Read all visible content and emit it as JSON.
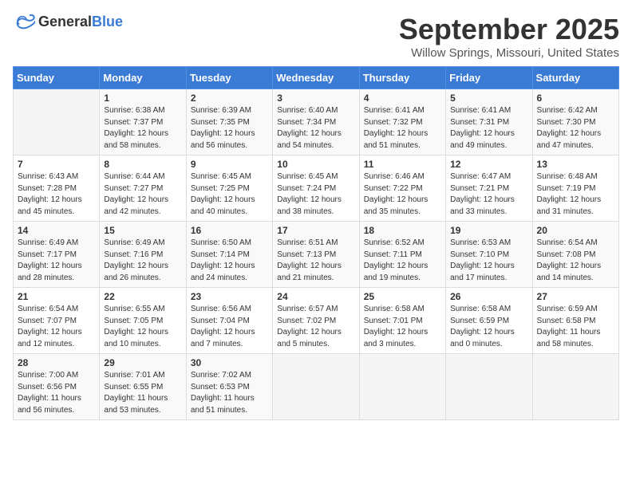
{
  "header": {
    "logo_general": "General",
    "logo_blue": "Blue",
    "month": "September 2025",
    "location": "Willow Springs, Missouri, United States"
  },
  "weekdays": [
    "Sunday",
    "Monday",
    "Tuesday",
    "Wednesday",
    "Thursday",
    "Friday",
    "Saturday"
  ],
  "weeks": [
    [
      {
        "day": "",
        "sunrise": "",
        "sunset": "",
        "daylight": ""
      },
      {
        "day": "1",
        "sunrise": "Sunrise: 6:38 AM",
        "sunset": "Sunset: 7:37 PM",
        "daylight": "Daylight: 12 hours and 58 minutes."
      },
      {
        "day": "2",
        "sunrise": "Sunrise: 6:39 AM",
        "sunset": "Sunset: 7:35 PM",
        "daylight": "Daylight: 12 hours and 56 minutes."
      },
      {
        "day": "3",
        "sunrise": "Sunrise: 6:40 AM",
        "sunset": "Sunset: 7:34 PM",
        "daylight": "Daylight: 12 hours and 54 minutes."
      },
      {
        "day": "4",
        "sunrise": "Sunrise: 6:41 AM",
        "sunset": "Sunset: 7:32 PM",
        "daylight": "Daylight: 12 hours and 51 minutes."
      },
      {
        "day": "5",
        "sunrise": "Sunrise: 6:41 AM",
        "sunset": "Sunset: 7:31 PM",
        "daylight": "Daylight: 12 hours and 49 minutes."
      },
      {
        "day": "6",
        "sunrise": "Sunrise: 6:42 AM",
        "sunset": "Sunset: 7:30 PM",
        "daylight": "Daylight: 12 hours and 47 minutes."
      }
    ],
    [
      {
        "day": "7",
        "sunrise": "Sunrise: 6:43 AM",
        "sunset": "Sunset: 7:28 PM",
        "daylight": "Daylight: 12 hours and 45 minutes."
      },
      {
        "day": "8",
        "sunrise": "Sunrise: 6:44 AM",
        "sunset": "Sunset: 7:27 PM",
        "daylight": "Daylight: 12 hours and 42 minutes."
      },
      {
        "day": "9",
        "sunrise": "Sunrise: 6:45 AM",
        "sunset": "Sunset: 7:25 PM",
        "daylight": "Daylight: 12 hours and 40 minutes."
      },
      {
        "day": "10",
        "sunrise": "Sunrise: 6:45 AM",
        "sunset": "Sunset: 7:24 PM",
        "daylight": "Daylight: 12 hours and 38 minutes."
      },
      {
        "day": "11",
        "sunrise": "Sunrise: 6:46 AM",
        "sunset": "Sunset: 7:22 PM",
        "daylight": "Daylight: 12 hours and 35 minutes."
      },
      {
        "day": "12",
        "sunrise": "Sunrise: 6:47 AM",
        "sunset": "Sunset: 7:21 PM",
        "daylight": "Daylight: 12 hours and 33 minutes."
      },
      {
        "day": "13",
        "sunrise": "Sunrise: 6:48 AM",
        "sunset": "Sunset: 7:19 PM",
        "daylight": "Daylight: 12 hours and 31 minutes."
      }
    ],
    [
      {
        "day": "14",
        "sunrise": "Sunrise: 6:49 AM",
        "sunset": "Sunset: 7:17 PM",
        "daylight": "Daylight: 12 hours and 28 minutes."
      },
      {
        "day": "15",
        "sunrise": "Sunrise: 6:49 AM",
        "sunset": "Sunset: 7:16 PM",
        "daylight": "Daylight: 12 hours and 26 minutes."
      },
      {
        "day": "16",
        "sunrise": "Sunrise: 6:50 AM",
        "sunset": "Sunset: 7:14 PM",
        "daylight": "Daylight: 12 hours and 24 minutes."
      },
      {
        "day": "17",
        "sunrise": "Sunrise: 6:51 AM",
        "sunset": "Sunset: 7:13 PM",
        "daylight": "Daylight: 12 hours and 21 minutes."
      },
      {
        "day": "18",
        "sunrise": "Sunrise: 6:52 AM",
        "sunset": "Sunset: 7:11 PM",
        "daylight": "Daylight: 12 hours and 19 minutes."
      },
      {
        "day": "19",
        "sunrise": "Sunrise: 6:53 AM",
        "sunset": "Sunset: 7:10 PM",
        "daylight": "Daylight: 12 hours and 17 minutes."
      },
      {
        "day": "20",
        "sunrise": "Sunrise: 6:54 AM",
        "sunset": "Sunset: 7:08 PM",
        "daylight": "Daylight: 12 hours and 14 minutes."
      }
    ],
    [
      {
        "day": "21",
        "sunrise": "Sunrise: 6:54 AM",
        "sunset": "Sunset: 7:07 PM",
        "daylight": "Daylight: 12 hours and 12 minutes."
      },
      {
        "day": "22",
        "sunrise": "Sunrise: 6:55 AM",
        "sunset": "Sunset: 7:05 PM",
        "daylight": "Daylight: 12 hours and 10 minutes."
      },
      {
        "day": "23",
        "sunrise": "Sunrise: 6:56 AM",
        "sunset": "Sunset: 7:04 PM",
        "daylight": "Daylight: 12 hours and 7 minutes."
      },
      {
        "day": "24",
        "sunrise": "Sunrise: 6:57 AM",
        "sunset": "Sunset: 7:02 PM",
        "daylight": "Daylight: 12 hours and 5 minutes."
      },
      {
        "day": "25",
        "sunrise": "Sunrise: 6:58 AM",
        "sunset": "Sunset: 7:01 PM",
        "daylight": "Daylight: 12 hours and 3 minutes."
      },
      {
        "day": "26",
        "sunrise": "Sunrise: 6:58 AM",
        "sunset": "Sunset: 6:59 PM",
        "daylight": "Daylight: 12 hours and 0 minutes."
      },
      {
        "day": "27",
        "sunrise": "Sunrise: 6:59 AM",
        "sunset": "Sunset: 6:58 PM",
        "daylight": "Daylight: 11 hours and 58 minutes."
      }
    ],
    [
      {
        "day": "28",
        "sunrise": "Sunrise: 7:00 AM",
        "sunset": "Sunset: 6:56 PM",
        "daylight": "Daylight: 11 hours and 56 minutes."
      },
      {
        "day": "29",
        "sunrise": "Sunrise: 7:01 AM",
        "sunset": "Sunset: 6:55 PM",
        "daylight": "Daylight: 11 hours and 53 minutes."
      },
      {
        "day": "30",
        "sunrise": "Sunrise: 7:02 AM",
        "sunset": "Sunset: 6:53 PM",
        "daylight": "Daylight: 11 hours and 51 minutes."
      },
      {
        "day": "",
        "sunrise": "",
        "sunset": "",
        "daylight": ""
      },
      {
        "day": "",
        "sunrise": "",
        "sunset": "",
        "daylight": ""
      },
      {
        "day": "",
        "sunrise": "",
        "sunset": "",
        "daylight": ""
      },
      {
        "day": "",
        "sunrise": "",
        "sunset": "",
        "daylight": ""
      }
    ]
  ]
}
